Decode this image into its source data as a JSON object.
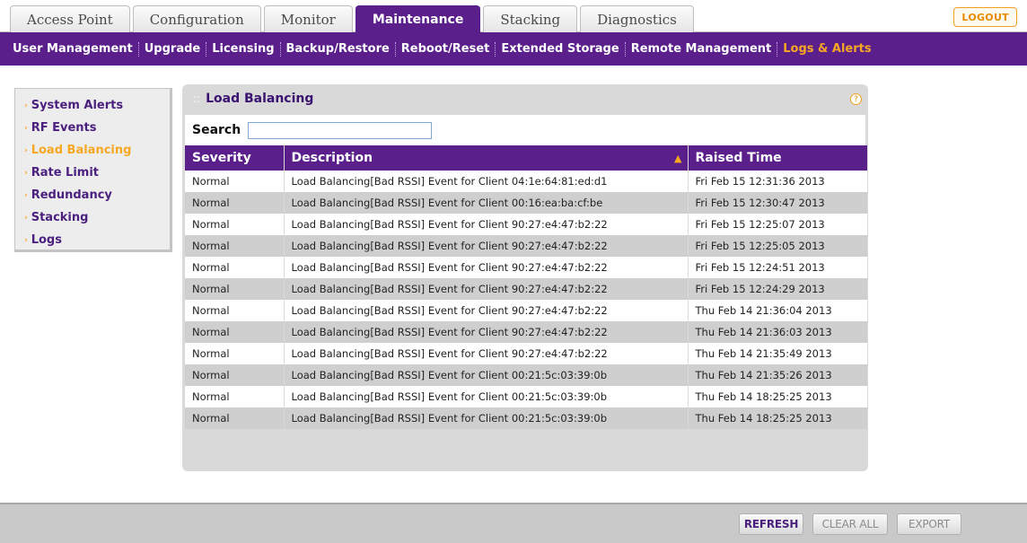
{
  "top_tabs": [
    {
      "label": "Access Point",
      "active": false
    },
    {
      "label": "Configuration",
      "active": false
    },
    {
      "label": "Monitor",
      "active": false
    },
    {
      "label": "Maintenance",
      "active": true
    },
    {
      "label": "Stacking",
      "active": false
    },
    {
      "label": "Diagnostics",
      "active": false
    }
  ],
  "logout_label": "LOGOUT",
  "sub_nav": [
    {
      "label": "User Management",
      "active": false
    },
    {
      "label": "Upgrade",
      "active": false
    },
    {
      "label": "Licensing",
      "active": false
    },
    {
      "label": "Backup/Restore",
      "active": false
    },
    {
      "label": "Reboot/Reset",
      "active": false
    },
    {
      "label": "Extended Storage",
      "active": false
    },
    {
      "label": "Remote Management",
      "active": false
    },
    {
      "label": "Logs & Alerts",
      "active": true
    }
  ],
  "side_menu": [
    {
      "label": "System Alerts",
      "active": false
    },
    {
      "label": "RF Events",
      "active": false
    },
    {
      "label": "Load Balancing",
      "active": true
    },
    {
      "label": "Rate Limit",
      "active": false
    },
    {
      "label": "Redundancy",
      "active": false
    },
    {
      "label": "Stacking",
      "active": false
    },
    {
      "label": "Logs",
      "active": false
    }
  ],
  "panel": {
    "title": "Load Balancing",
    "help_glyph": "?",
    "search_label": "Search",
    "search_value": ""
  },
  "table": {
    "columns": [
      "Severity",
      "Description",
      "Raised Time"
    ],
    "rows": [
      [
        "Normal",
        "Load Balancing[Bad RSSI] Event for Client 04:1e:64:81:ed:d1",
        "Fri Feb 15 12:31:36 2013"
      ],
      [
        "Normal",
        "Load Balancing[Bad RSSI] Event for Client 00:16:ea:ba:cf:be",
        "Fri Feb 15 12:30:47 2013"
      ],
      [
        "Normal",
        "Load Balancing[Bad RSSI] Event for Client 90:27:e4:47:b2:22",
        "Fri Feb 15 12:25:07 2013"
      ],
      [
        "Normal",
        "Load Balancing[Bad RSSI] Event for Client 90:27:e4:47:b2:22",
        "Fri Feb 15 12:25:05 2013"
      ],
      [
        "Normal",
        "Load Balancing[Bad RSSI] Event for Client 90:27:e4:47:b2:22",
        "Fri Feb 15 12:24:51 2013"
      ],
      [
        "Normal",
        "Load Balancing[Bad RSSI] Event for Client 90:27:e4:47:b2:22",
        "Fri Feb 15 12:24:29 2013"
      ],
      [
        "Normal",
        "Load Balancing[Bad RSSI] Event for Client 90:27:e4:47:b2:22",
        "Thu Feb 14 21:36:04 2013"
      ],
      [
        "Normal",
        "Load Balancing[Bad RSSI] Event for Client 90:27:e4:47:b2:22",
        "Thu Feb 14 21:36:03 2013"
      ],
      [
        "Normal",
        "Load Balancing[Bad RSSI] Event for Client 90:27:e4:47:b2:22",
        "Thu Feb 14 21:35:49 2013"
      ],
      [
        "Normal",
        "Load Balancing[Bad RSSI] Event for Client 00:21:5c:03:39:0b",
        "Thu Feb 14 21:35:26 2013"
      ],
      [
        "Normal",
        "Load Balancing[Bad RSSI] Event for Client 00:21:5c:03:39:0b",
        "Thu Feb 14 18:25:25 2013"
      ],
      [
        "Normal",
        "Load Balancing[Bad RSSI] Event for Client 00:21:5c:03:39:0b",
        "Thu Feb 14 18:25:25 2013"
      ]
    ]
  },
  "footer_buttons": {
    "refresh": "REFRESH",
    "clear_all": "CLEAR ALL",
    "export": "EXPORT"
  },
  "colors": {
    "brand_purple": "#5a1f8b",
    "accent_orange": "#f7a823"
  },
  "icons": {
    "bullet": "chevron-right-icon",
    "sort": "sort-icon",
    "help": "help-icon"
  }
}
